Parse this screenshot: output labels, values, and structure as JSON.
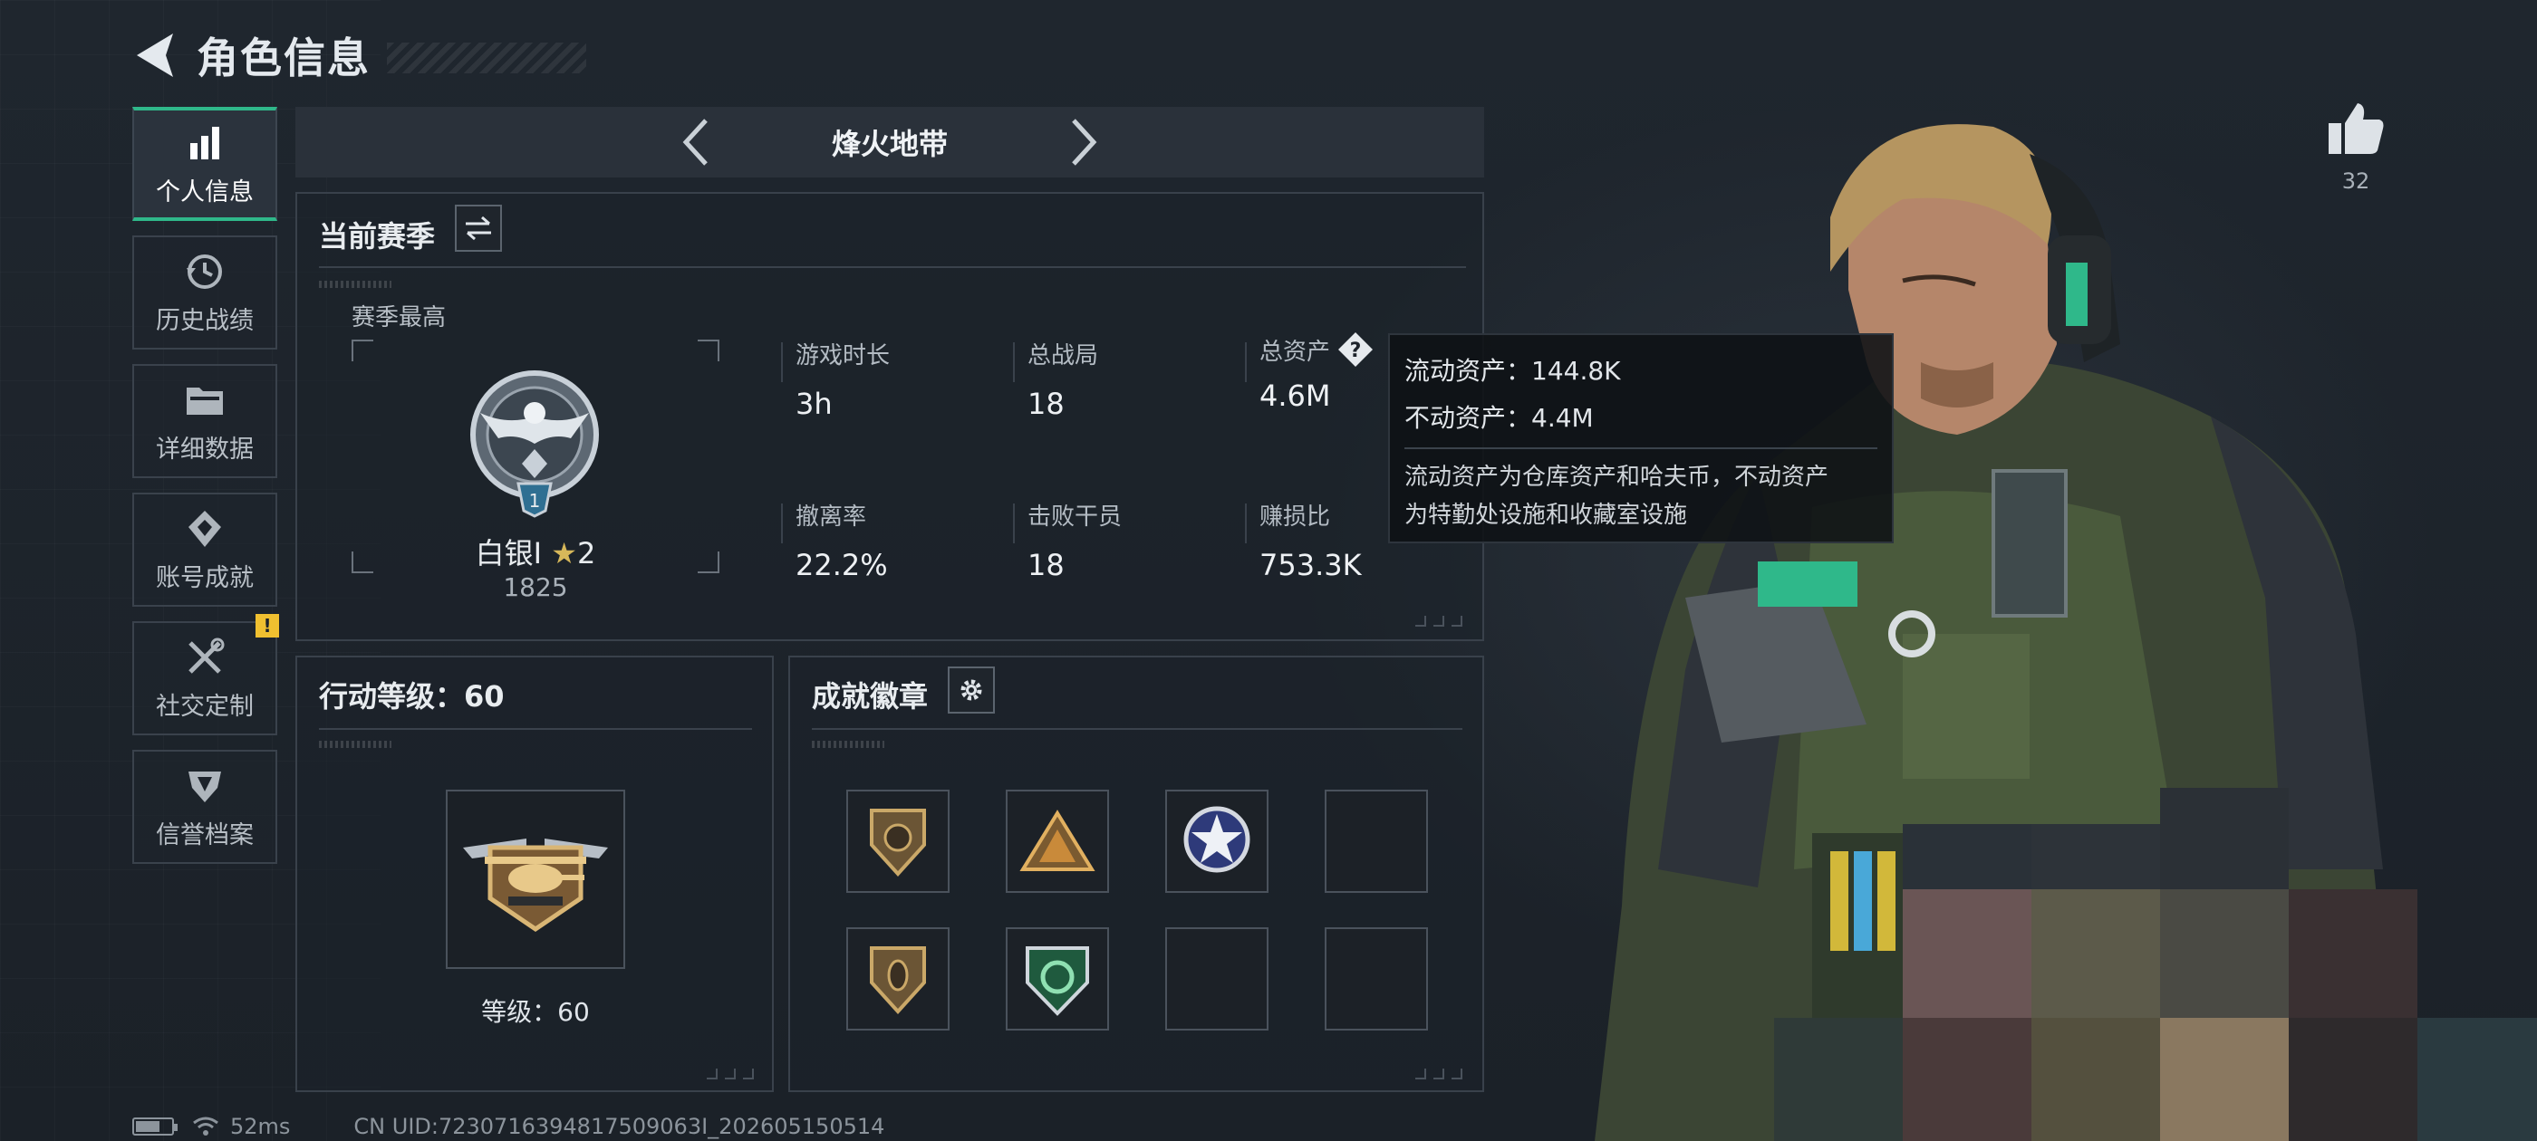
{
  "header": {
    "title": "角色信息"
  },
  "sidebar": {
    "items": [
      {
        "label": "个人信息",
        "icon": "bar-chart-icon",
        "active": true
      },
      {
        "label": "历史战绩",
        "icon": "history-icon"
      },
      {
        "label": "详细数据",
        "icon": "folder-icon"
      },
      {
        "label": "账号成就",
        "icon": "achievement-icon"
      },
      {
        "label": "社交定制",
        "icon": "tools-icon",
        "badge": "!"
      },
      {
        "label": "信誉档案",
        "icon": "credit-shield-icon"
      }
    ]
  },
  "mode": {
    "title": "烽火地带"
  },
  "season": {
    "title": "当前赛季",
    "best_label": "赛季最高",
    "rank_name": "白银I",
    "rank_stars": "2",
    "rank_score": "1825",
    "stats": [
      {
        "label": "游戏时长",
        "value": "3h"
      },
      {
        "label": "总战局",
        "value": "18"
      },
      {
        "label": "总资产",
        "value": "4.6M"
      },
      {
        "label": "撤离率",
        "value": "22.2%"
      },
      {
        "label": "击败干员",
        "value": "18"
      },
      {
        "label": "赚损比",
        "value": "753.3K"
      }
    ]
  },
  "tooltip": {
    "liquid": "流动资产：144.8K",
    "fixed": "不动资产：4.4M",
    "desc_line1": "流动资产为仓库资产和哈夫币，不动资产",
    "desc_line2": "为特勤处设施和收藏室设施"
  },
  "level_panel": {
    "title": "行动等级：60",
    "level_text": "等级：60"
  },
  "achievements": {
    "title": "成就徽章",
    "slots": [
      "shield-badge-icon",
      "triangle-badge-icon",
      "star-emblem-icon",
      "empty",
      "shield-badge-icon",
      "green-badge-icon",
      "empty",
      "empty"
    ]
  },
  "likes": {
    "count": "32"
  },
  "status_bar": {
    "ping": "52ms",
    "uid": "CN UID:7230716394817509063I_202605150514"
  },
  "colors": {
    "accent": "#2fb88a",
    "warning": "#f0c030",
    "panel_border": "#39414b"
  }
}
